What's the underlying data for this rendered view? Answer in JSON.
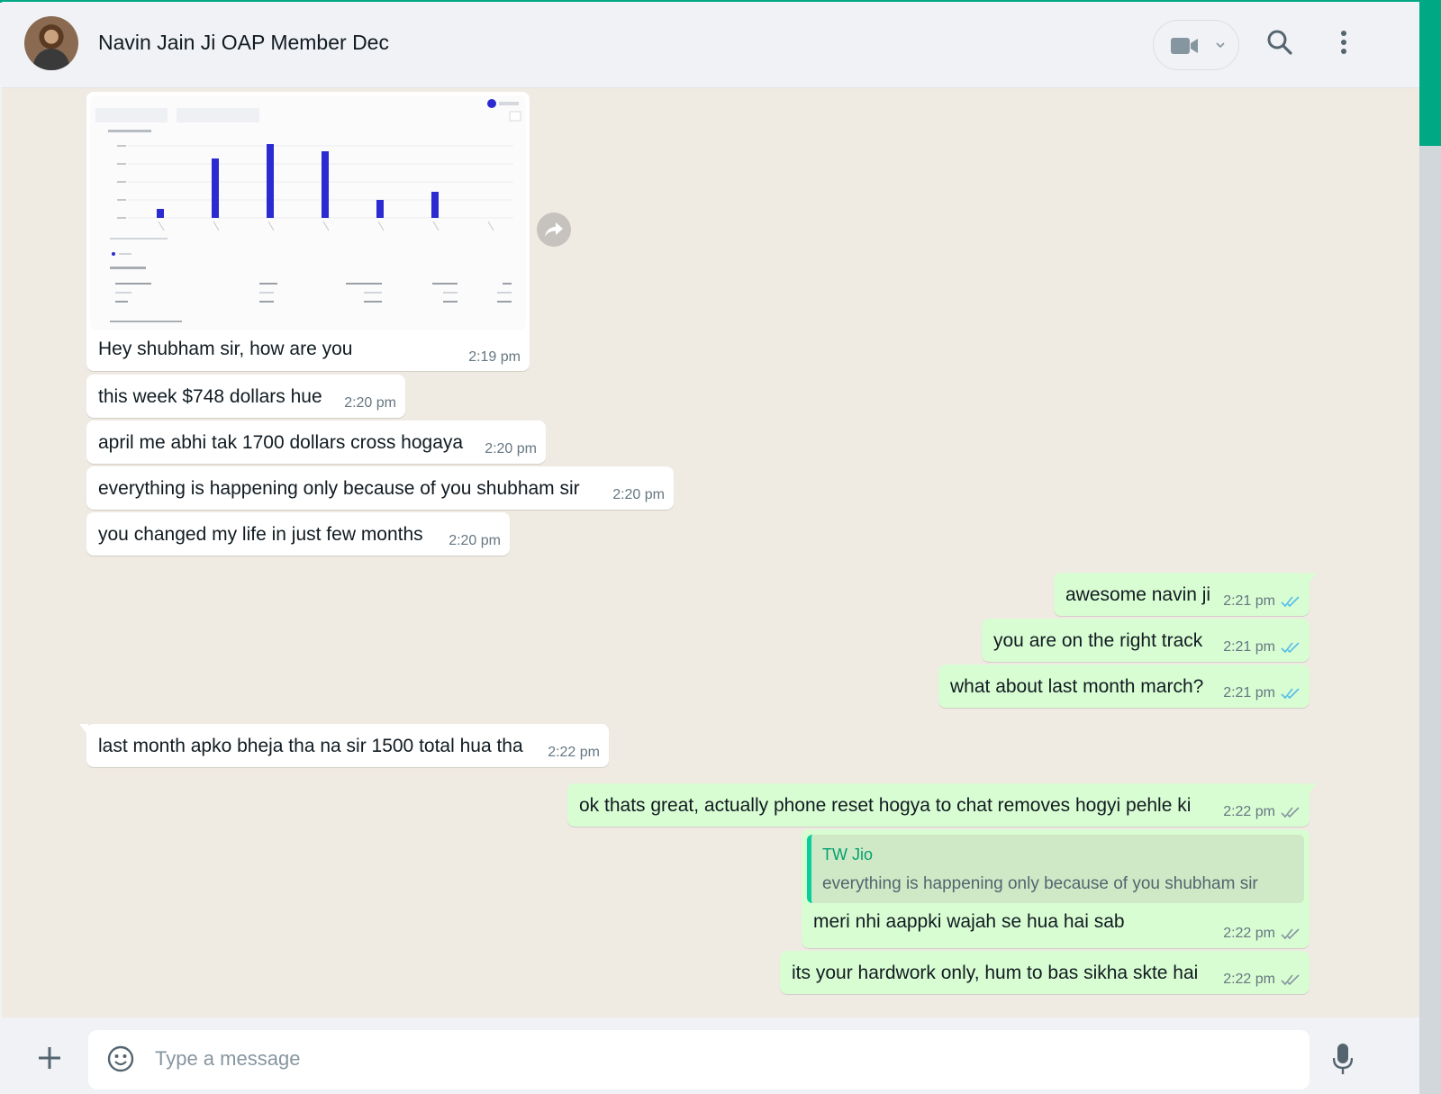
{
  "header": {
    "title": "Navin Jain Ji OAP Member Dec",
    "avatar_icon": "contact-avatar",
    "video_icon": "video-camera-icon",
    "search_icon": "search-icon",
    "menu_icon": "more-vertical-icon"
  },
  "messages": [
    {
      "dir": "in",
      "type": "image",
      "text": "Hey shubham sir, how are you",
      "time": "2:19 pm"
    },
    {
      "dir": "in",
      "text": "this week $748 dollars hue",
      "time": "2:20 pm"
    },
    {
      "dir": "in",
      "text": "april me abhi tak 1700 dollars cross hogaya",
      "time": "2:20 pm"
    },
    {
      "dir": "in",
      "text": "everything  is happening only because of you shubham sir",
      "time": "2:20 pm"
    },
    {
      "dir": "in",
      "text": "you changed my life in just few months",
      "time": "2:20 pm"
    },
    {
      "dir": "out",
      "text": "awesome navin ji",
      "time": "2:21 pm",
      "status": "read"
    },
    {
      "dir": "out",
      "text": "you are on the right track",
      "time": "2:21 pm",
      "status": "read"
    },
    {
      "dir": "out",
      "text": "what about last month march?",
      "time": "2:21 pm",
      "status": "read"
    },
    {
      "dir": "in",
      "text": "last month apko bheja tha na sir 1500 total hua tha",
      "time": "2:22 pm"
    },
    {
      "dir": "out",
      "text": "ok thats great, actually phone reset hogya to chat removes hogyi pehle ki",
      "time": "2:22 pm",
      "status": "delivered"
    },
    {
      "dir": "out",
      "text": "meri nhi aappki wajah se hua hai sab",
      "time": "2:22 pm",
      "status": "delivered",
      "quoted": {
        "author": "TW Jio",
        "text": "everything  is happening only because of you shubham sir"
      }
    },
    {
      "dir": "out",
      "text": "its your hardwork only, hum to bas sikha skte hai",
      "time": "2:22 pm",
      "status": "delivered"
    }
  ],
  "colors": {
    "accent": "#00a884",
    "incoming_bubble": "#ffffff",
    "outgoing_bubble": "#d9fdd3",
    "read_tick": "#53bdeb",
    "delivered_tick": "#8696a0",
    "chart_bar": "#2b2bd1"
  },
  "composer": {
    "placeholder": "Type a message",
    "value": "",
    "attach_icon": "plus-icon",
    "sticker_icon": "sticker-icon",
    "mic_icon": "microphone-icon"
  }
}
